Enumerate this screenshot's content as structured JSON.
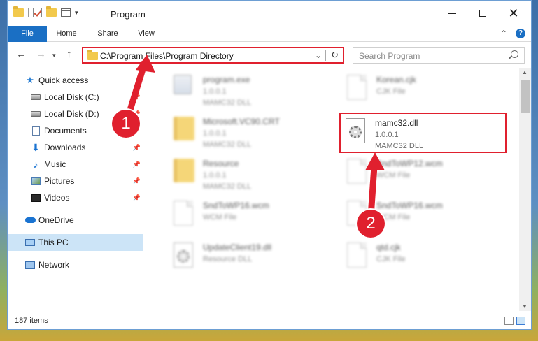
{
  "window": {
    "title": "Program"
  },
  "ribbon": {
    "file": "File",
    "home": "Home",
    "share": "Share",
    "view": "View"
  },
  "address": {
    "path": "C:\\Program Files\\Program Directory"
  },
  "search": {
    "placeholder": "Search Program"
  },
  "sidebar": {
    "items": [
      {
        "label": "Quick access",
        "icon": "star-icon"
      },
      {
        "label": "Local Disk (C:)",
        "icon": "disk-icon",
        "pinned": true
      },
      {
        "label": "Local Disk (D:)",
        "icon": "disk-icon",
        "pinned": true
      },
      {
        "label": "Documents",
        "icon": "document-icon",
        "pinned": true
      },
      {
        "label": "Downloads",
        "icon": "download-icon",
        "pinned": true
      },
      {
        "label": "Music",
        "icon": "music-icon",
        "pinned": true
      },
      {
        "label": "Pictures",
        "icon": "pictures-icon",
        "pinned": true
      },
      {
        "label": "Videos",
        "icon": "videos-icon",
        "pinned": true
      },
      {
        "label": "OneDrive",
        "icon": "cloud-icon"
      },
      {
        "label": "This PC",
        "icon": "computer-icon",
        "selected": true
      },
      {
        "label": "Network",
        "icon": "network-icon"
      }
    ]
  },
  "files": [
    {
      "name": "program.exe",
      "line2": "1.0.0.1",
      "line3": "MAMC32 DLL",
      "icon": "exe-icon"
    },
    {
      "name": "Korean.cjk",
      "line2": "CJK File",
      "line3": "",
      "icon": "file-icon"
    },
    {
      "name": "Microsoft.VC90.CRT",
      "line2": "1.0.0.1",
      "line3": "MAMC32 DLL",
      "icon": "folder-icon"
    },
    {
      "name": "mamc32.dll",
      "line2": "1.0.0.1",
      "line3": "MAMC32 DLL",
      "icon": "dll-icon",
      "highlighted": true
    },
    {
      "name": "Resource",
      "line2": "1.0.0.1",
      "line3": "MAMC32 DLL",
      "icon": "folder-icon"
    },
    {
      "name": "SndToWP12.wcm",
      "line2": "WCM File",
      "line3": "",
      "icon": "file-icon"
    },
    {
      "name": "SndToWP16.wcm",
      "line2": "WCM File",
      "line3": "",
      "icon": "file-icon"
    },
    {
      "name": "SndToWP16.wcm",
      "line2": "WCM File",
      "line3": "",
      "icon": "file-icon"
    },
    {
      "name": "UpdateClient19.dll",
      "line2": "Resource DLL",
      "line3": "",
      "icon": "dll-icon"
    },
    {
      "name": "qtd.cjk",
      "line2": "CJK File",
      "line3": "",
      "icon": "file-icon"
    }
  ],
  "status": {
    "count": "187 items"
  },
  "callouts": {
    "one": "1",
    "two": "2"
  },
  "colors": {
    "accent": "#1a6fc4",
    "highlight": "#e0202e",
    "selected": "#cce4f7"
  }
}
